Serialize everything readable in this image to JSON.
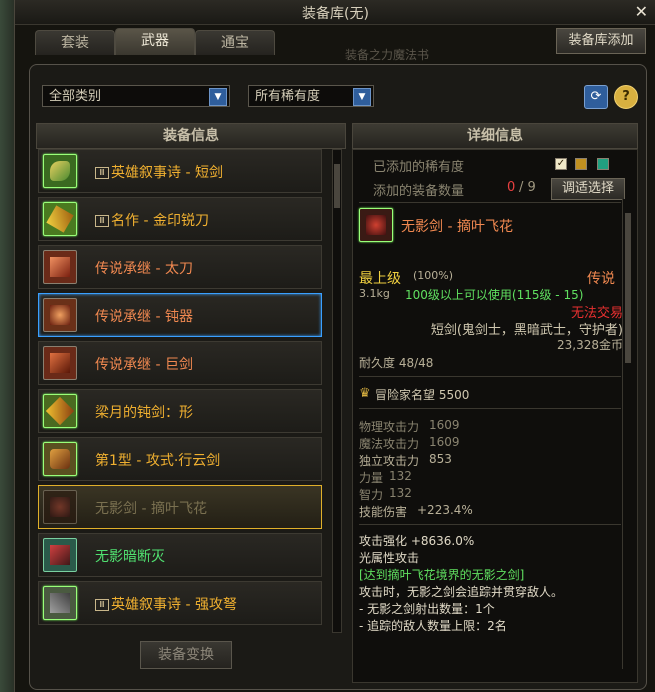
{
  "window": {
    "title": "装备库(无)",
    "close_icon": "close-icon"
  },
  "tabs": [
    {
      "label": "套装"
    },
    {
      "label": "武器"
    },
    {
      "label": "通宝"
    }
  ],
  "add_button": "装备库添加",
  "ghost_text": "装备之力魔法书",
  "filters": {
    "category": "全部类别",
    "rarity": "所有稀有度"
  },
  "list_header": "装备信息",
  "detail_header": "详细信息",
  "list_items": [
    {
      "label": "英雄叙事诗 - 短剑",
      "badge": "Ⅲ",
      "color": "#f0b030"
    },
    {
      "label": "名作 - 金印锐刀",
      "badge": "Ⅲ",
      "color": "#f0b030"
    },
    {
      "label": "传说承继 - 太刀",
      "badge": "",
      "color": "#f08850"
    },
    {
      "label": "传说承继 - 钝器",
      "badge": "",
      "color": "#f08850"
    },
    {
      "label": "传说承继 - 巨剑",
      "badge": "",
      "color": "#f08850"
    },
    {
      "label": "梁月的钝剑：形",
      "badge": "",
      "color": "#f0b030"
    },
    {
      "label": "第1型 - 攻式·行云剑",
      "badge": "",
      "color": "#f0b030"
    },
    {
      "label": "无影剑 - 摘叶飞花",
      "badge": "",
      "color": "#7a7050"
    },
    {
      "label": "无影暗断灭",
      "badge": "",
      "color": "#50e070"
    },
    {
      "label": "英雄叙事诗 - 强攻弩",
      "badge": "Ⅲ",
      "color": "#f0b030"
    }
  ],
  "convert_button": "装备变换",
  "detail": {
    "added_rarity_label": "已添加的稀有度",
    "added_count_label": "添加的装备数量",
    "added_count": "0",
    "added_total": "/ 9",
    "adjust_button": "调适选择",
    "item_name": "无影剑 - 摘叶飞花",
    "level_label": "最上级",
    "level_pct": "(100%)",
    "rarity": "传说",
    "weight": "3.1kg",
    "usable": "100级以上可以使用(115级 - 15)",
    "no_trade": "无法交易",
    "classes": "短剑(鬼剑士，黑暗武士，守护者)",
    "price": "23,328金币",
    "durability": "耐久度 48/48",
    "fame": "冒险家名望 5500",
    "stats": [
      {
        "label": "物理攻击力",
        "value": "1609"
      },
      {
        "label": "魔法攻击力",
        "value": "1609"
      },
      {
        "label": "独立攻击力",
        "value": "853"
      },
      {
        "label": "力量",
        "value": "132"
      },
      {
        "label": "智力",
        "value": "132"
      },
      {
        "label": "技能伤害",
        "value": "+223.4%"
      }
    ],
    "atk_boost": "攻击强化 +8636.0%",
    "element": "光属性攻击",
    "set_title": "[达到摘叶飞花境界的无影之剑]",
    "desc1": "攻击时，无影之剑会追踪并贯穿敌人。",
    "desc2": "- 无影之剑射出数量：1个",
    "desc3": "- 追踪的敌人数量上限：2名"
  },
  "colors": {
    "accent_blue": "#3aa0ff",
    "gold_border": "#e0b02a",
    "rarity_orange": "#f08850",
    "green": "#50e070",
    "red": "#e83030"
  }
}
